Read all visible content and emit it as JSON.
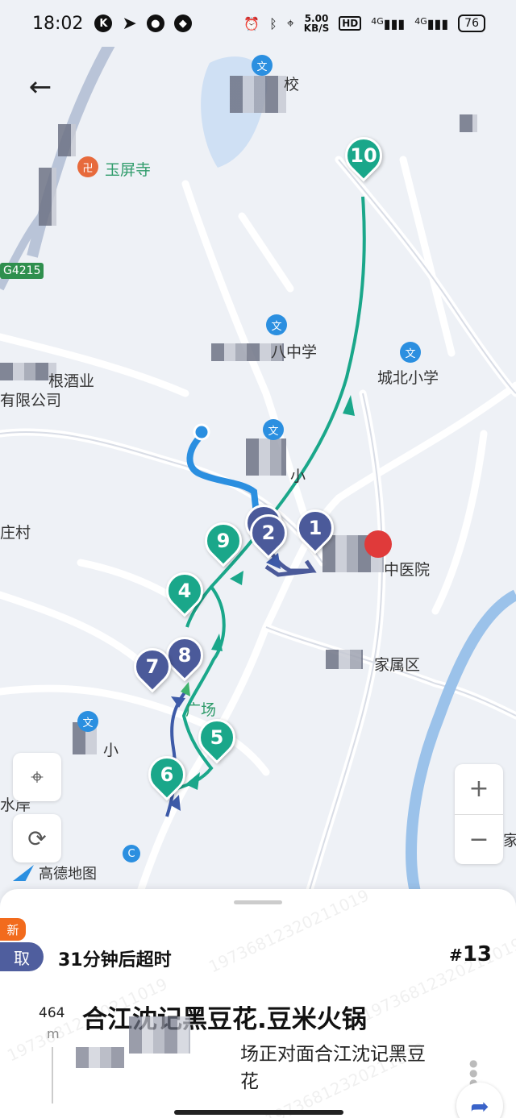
{
  "status_bar": {
    "time": "18:02",
    "left_icons": [
      "k-icon",
      "send-icon",
      "wechat-icon",
      "app-icon"
    ],
    "speed_value": "5.00",
    "speed_unit": "KB/S",
    "hd_label": "HD",
    "network_1": "4G",
    "network_2": "4G",
    "battery": "76"
  },
  "map": {
    "pois": {
      "yuping_temple": "玉屏寺",
      "highway_badge": "G4215",
      "school_8": "八中学",
      "chengbei_primary": "城北小学",
      "winery": "根酒业",
      "company": "有限公司",
      "village": "庄村",
      "school_small": "小",
      "hospital": "中医院",
      "family_area": "家属区",
      "plaza": "广场",
      "primary_2": "小",
      "water_bank": "水岸",
      "school_top": "校",
      "right_edge": "家"
    },
    "poi_icon_char": "文",
    "pins": {
      "p1": "1",
      "p2": "2",
      "p3": "",
      "p4": "4",
      "p5": "5",
      "p6": "6",
      "p7": "7",
      "p8": "8",
      "p9": "9",
      "p10": "10"
    },
    "logo_text": "高德地图",
    "zoom_in": "+",
    "zoom_out": "−"
  },
  "order": {
    "new_badge": "新",
    "take_badge": "取",
    "timeout_text": "31分钟后超时",
    "order_number": "13",
    "order_hash": "#",
    "distance": "464",
    "distance_unit": "m",
    "shop_name": "合江沈记黑豆花.豆米火锅",
    "address": "场正对面合江沈记黑豆花",
    "watermark": "19736812320211019"
  },
  "colors": {
    "teal_route": "#1aa78a",
    "navy_route": "#4b5a9a",
    "blue_path": "#2b8fe0",
    "new_badge": "#f26b1d"
  }
}
